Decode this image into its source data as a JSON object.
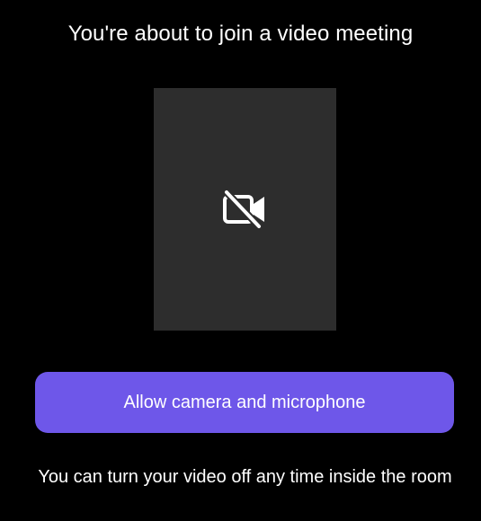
{
  "header": {
    "title": "You're about to join a video meeting"
  },
  "preview": {
    "icon": "camera-off-icon",
    "background": "#2d2d2d"
  },
  "actions": {
    "allow_label": "Allow camera and microphone",
    "accent": "#6e57e9"
  },
  "footer": {
    "hint": "You can turn your video off any time inside the room"
  }
}
